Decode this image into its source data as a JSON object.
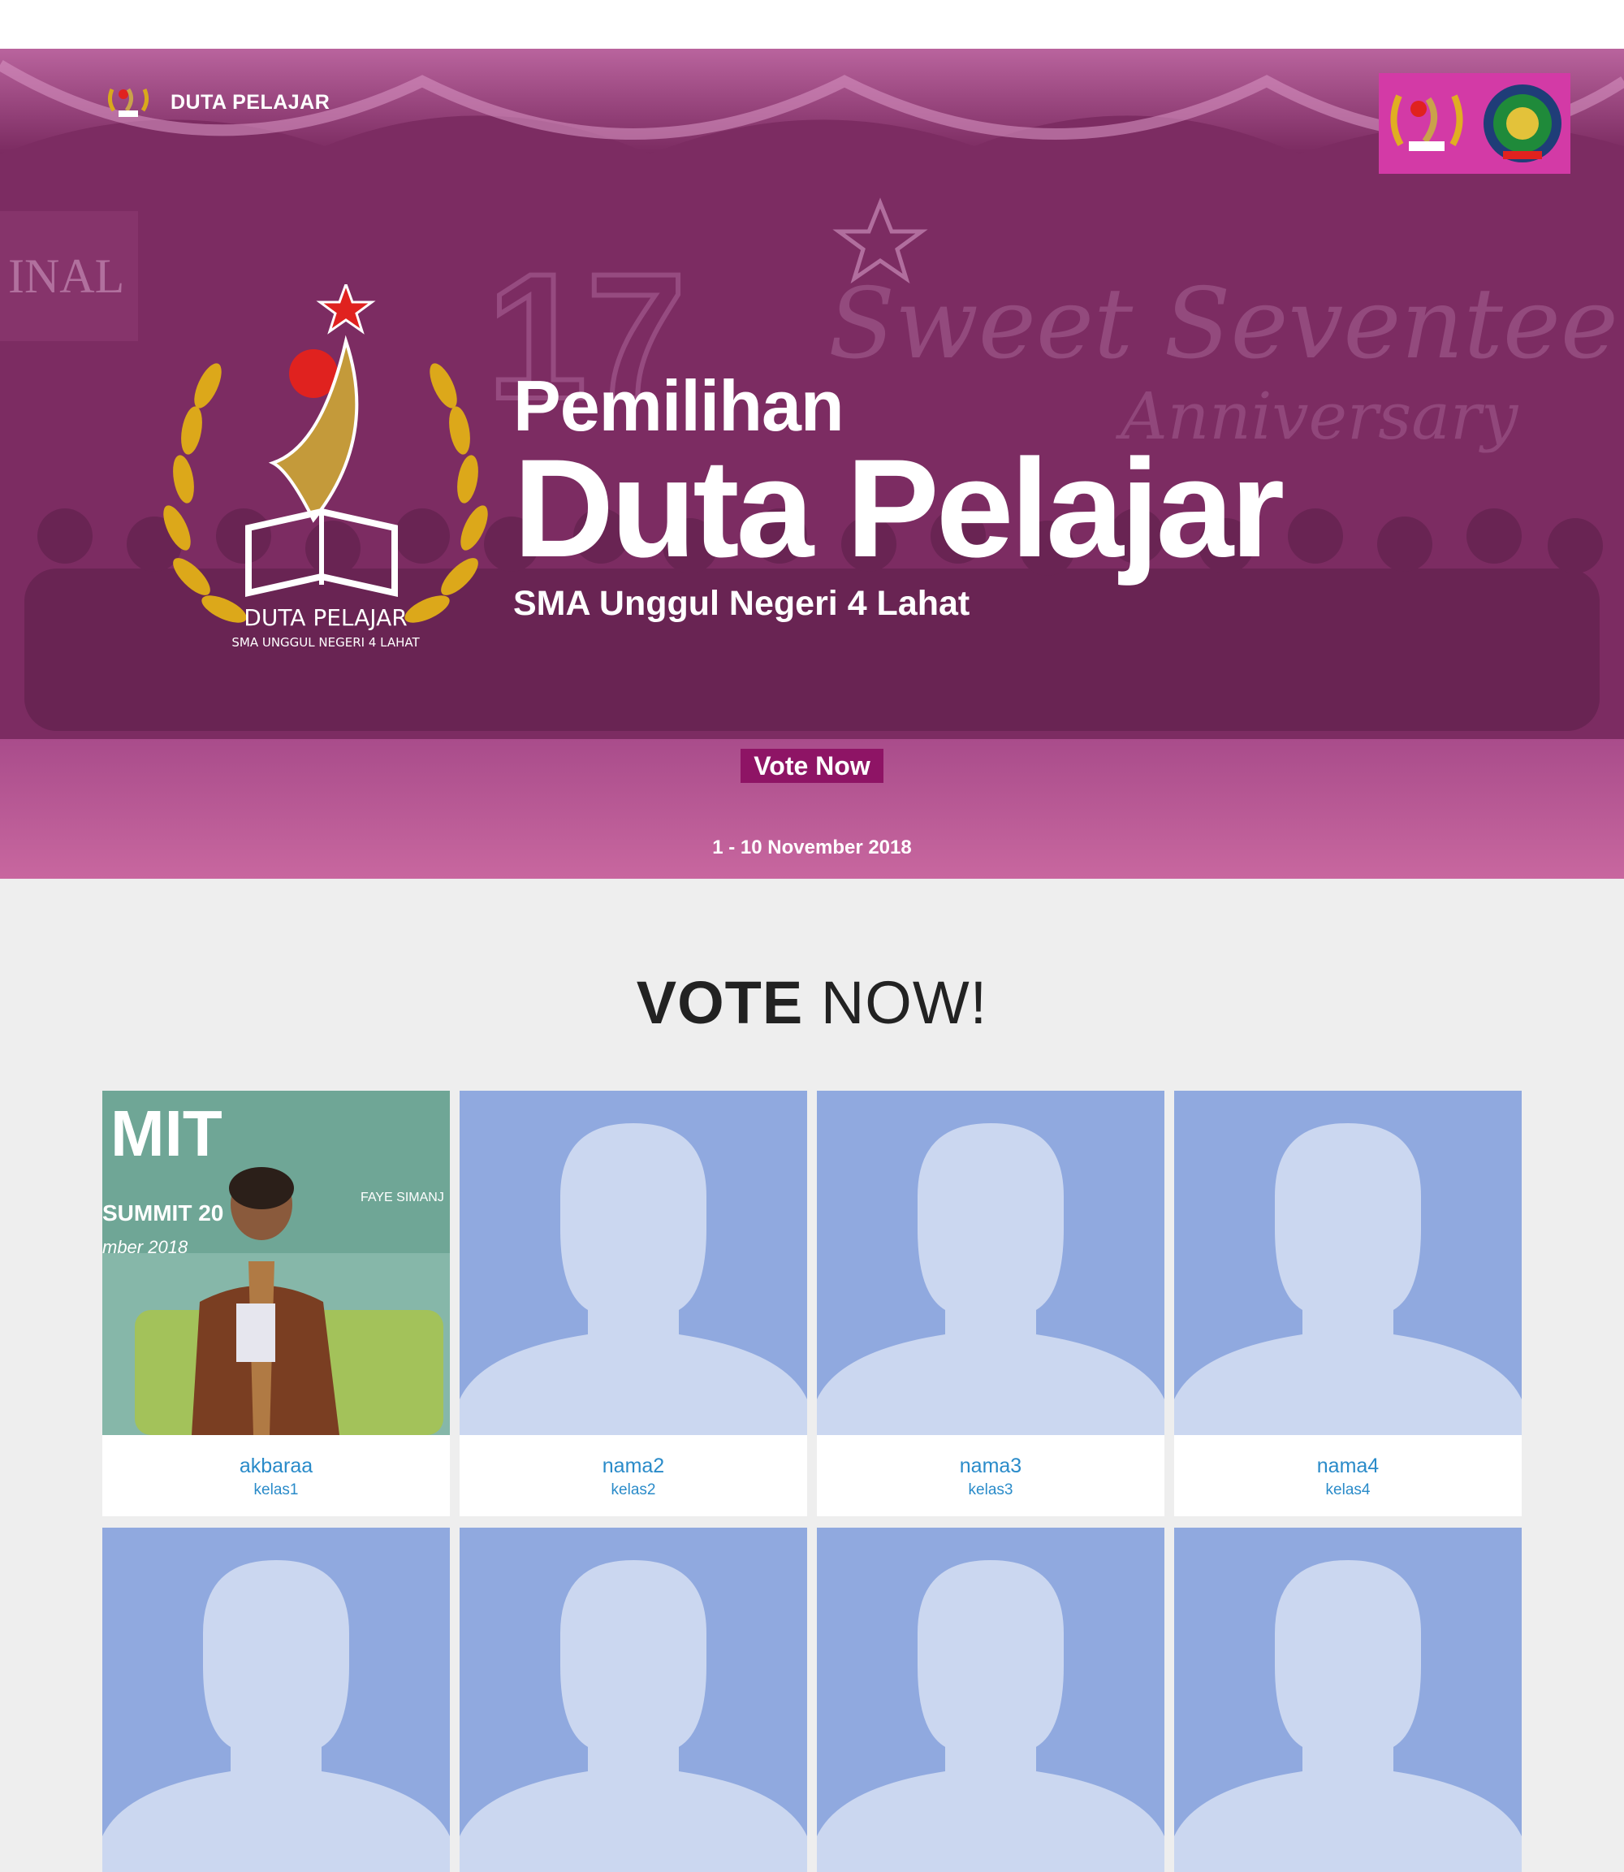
{
  "nav": {
    "brand": "DUTA PELAJAR"
  },
  "hero": {
    "pre_title": "Pemilihan",
    "title": "Duta Pelajar",
    "subtitle": "SMA Unggul Negeri 4 Lahat",
    "emblem_text": "DUTA PELAJAR",
    "emblem_subtext": "SMA UNGGUL NEGERI 4 LAHAT",
    "button_label": "Vote Now",
    "date": "1 - 10 November 2018",
    "background_words": [
      "17",
      "Sweet Seventeen",
      "Anniversary",
      "INAL"
    ],
    "colors": {
      "overlay": "#8e2a6e",
      "button": "#8e1465",
      "logo_box": "#d33aa6"
    }
  },
  "section": {
    "title_bold": "VOTE",
    "title_light": "NOW!"
  },
  "candidates": [
    {
      "name": "akbaraa",
      "class": "kelas1",
      "photo": "photo"
    },
    {
      "name": "nama2",
      "class": "kelas2",
      "photo": "placeholder"
    },
    {
      "name": "nama3",
      "class": "kelas3",
      "photo": "placeholder"
    },
    {
      "name": "nama4",
      "class": "kelas4",
      "photo": "placeholder"
    },
    {
      "name": "",
      "class": "",
      "photo": "placeholder"
    },
    {
      "name": "",
      "class": "",
      "photo": "placeholder"
    },
    {
      "name": "",
      "class": "",
      "photo": "placeholder"
    },
    {
      "name": "",
      "class": "",
      "photo": "placeholder"
    }
  ],
  "photo_text": {
    "line1": "MIT",
    "line2": "SUMMIT 20",
    "line3": "mber 2018",
    "line4": "FAYE SIMANJ"
  }
}
